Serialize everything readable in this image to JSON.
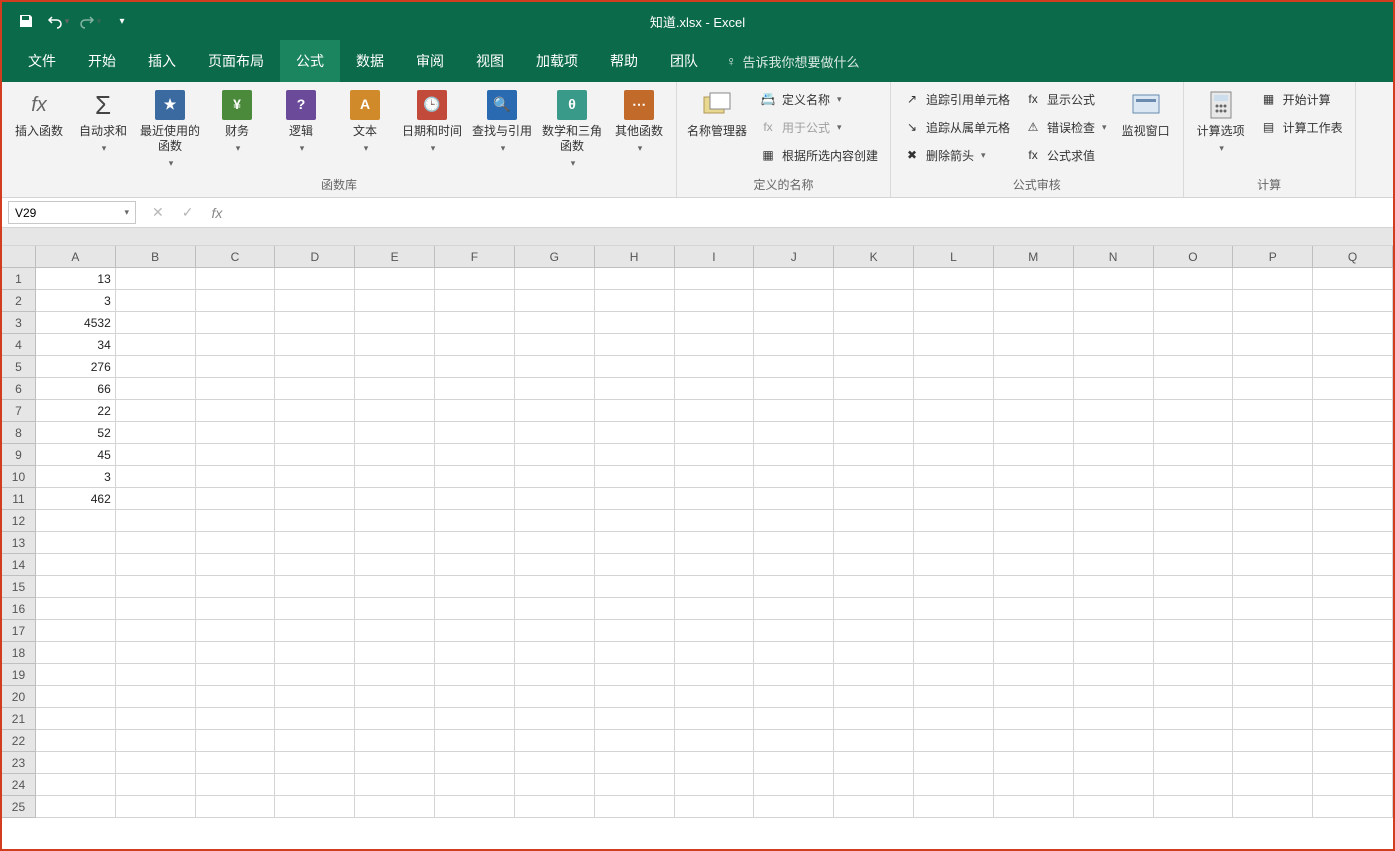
{
  "title": "知道.xlsx - Excel",
  "qat": {
    "save": "保存",
    "undo": "撤销",
    "redo": "重做"
  },
  "tabs": [
    "文件",
    "开始",
    "插入",
    "页面布局",
    "公式",
    "数据",
    "审阅",
    "视图",
    "加载项",
    "帮助",
    "团队"
  ],
  "active_tab_index": 4,
  "tellme": {
    "placeholder": "告诉我你想要做什么"
  },
  "ribbon": {
    "groups": [
      {
        "name": "函数库",
        "big": [
          {
            "id": "insert-fn",
            "label": "插入函数",
            "icon": "fx"
          },
          {
            "id": "autosum",
            "label": "自动求和",
            "icon": "Σ",
            "dd": true
          },
          {
            "id": "recent",
            "label": "最近使用的函数",
            "icon": "★",
            "tile": "t-blue",
            "dd": true
          },
          {
            "id": "financial",
            "label": "财务",
            "icon": "¥",
            "tile": "t-green",
            "dd": true
          },
          {
            "id": "logical",
            "label": "逻辑",
            "icon": "?",
            "tile": "t-purple",
            "dd": true
          },
          {
            "id": "text",
            "label": "文本",
            "icon": "A",
            "tile": "t-orange",
            "dd": true
          },
          {
            "id": "datetime",
            "label": "日期和时间",
            "icon": "🕒",
            "tile": "t-red",
            "dd": true
          },
          {
            "id": "lookup",
            "label": "查找与引用",
            "icon": "🔍",
            "tile": "t-blue2",
            "dd": true
          },
          {
            "id": "math",
            "label": "数学和三角函数",
            "icon": "θ",
            "tile": "t-teal",
            "dd": true
          },
          {
            "id": "other",
            "label": "其他函数",
            "icon": "⋯",
            "tile": "t-dorange",
            "dd": true
          }
        ]
      },
      {
        "name": "定义的名称",
        "big": [
          {
            "id": "name-mgr",
            "label": "名称管理器",
            "icon": "mgr"
          }
        ],
        "small": [
          {
            "id": "define-name",
            "label": "定义名称",
            "dd": true
          },
          {
            "id": "use-in-formula",
            "label": "用于公式",
            "dd": true,
            "dim": true
          },
          {
            "id": "create-from-sel",
            "label": "根据所选内容创建"
          }
        ]
      },
      {
        "name": "公式审核",
        "small_cols": [
          [
            {
              "id": "trace-precedents",
              "label": "追踪引用单元格"
            },
            {
              "id": "trace-dependents",
              "label": "追踪从属单元格"
            },
            {
              "id": "remove-arrows",
              "label": "删除箭头",
              "dd": true
            }
          ],
          [
            {
              "id": "show-formulas",
              "label": "显示公式"
            },
            {
              "id": "error-check",
              "label": "错误检查",
              "dd": true
            },
            {
              "id": "eval-formula",
              "label": "公式求值"
            }
          ]
        ],
        "big_after": [
          {
            "id": "watch-window",
            "label": "监视窗口",
            "icon": "watch"
          }
        ]
      },
      {
        "name": "计算",
        "big": [
          {
            "id": "calc-options",
            "label": "计算选项",
            "icon": "calc",
            "dd": true
          }
        ],
        "small": [
          {
            "id": "calc-now",
            "label": "开始计算"
          },
          {
            "id": "calc-sheet",
            "label": "计算工作表"
          }
        ]
      }
    ]
  },
  "namebox": "V29",
  "formula": "",
  "columns": [
    "A",
    "B",
    "C",
    "D",
    "E",
    "F",
    "G",
    "H",
    "I",
    "J",
    "K",
    "L",
    "M",
    "N",
    "O",
    "P",
    "Q"
  ],
  "row_count": 25,
  "cells": {
    "A1": "13",
    "A2": "3",
    "A3": "4532",
    "A4": "34",
    "A5": "276",
    "A6": "66",
    "A7": "22",
    "A8": "52",
    "A9": "45",
    "A10": "3",
    "A11": "462"
  }
}
